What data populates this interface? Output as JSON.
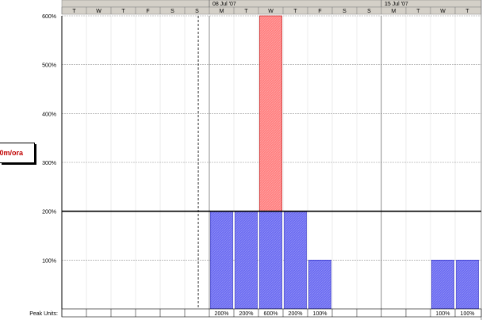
{
  "resource_label": "0m/ora",
  "peak_units_label": "Peak Units:",
  "weeks": [
    "08 Jul '07",
    "15 Jul '07"
  ],
  "colors": {
    "allocated": "#6b6bf0",
    "overallocated": "#ff7f7f",
    "header": "#d4d0c8"
  },
  "chart_data": {
    "type": "bar",
    "title": "",
    "xlabel": "",
    "ylabel": "",
    "ylim": [
      0,
      600
    ],
    "y_ticks": [
      "100%",
      "200%",
      "300%",
      "400%",
      "500%",
      "600%"
    ],
    "day_letters": [
      "T",
      "W",
      "T",
      "F",
      "S",
      "S",
      "M",
      "T",
      "W",
      "T",
      "F",
      "S",
      "S",
      "M",
      "T",
      "W",
      "T"
    ],
    "max_units": 200,
    "values": [
      0,
      0,
      0,
      0,
      0,
      0,
      200,
      200,
      600,
      200,
      100,
      0,
      0,
      0,
      0,
      100,
      100
    ],
    "peak_labels": [
      "",
      "",
      "",
      "",
      "",
      "",
      "200%",
      "200%",
      "600%",
      "200%",
      "100%",
      "",
      "",
      "",
      "",
      "100%",
      "100%"
    ]
  }
}
